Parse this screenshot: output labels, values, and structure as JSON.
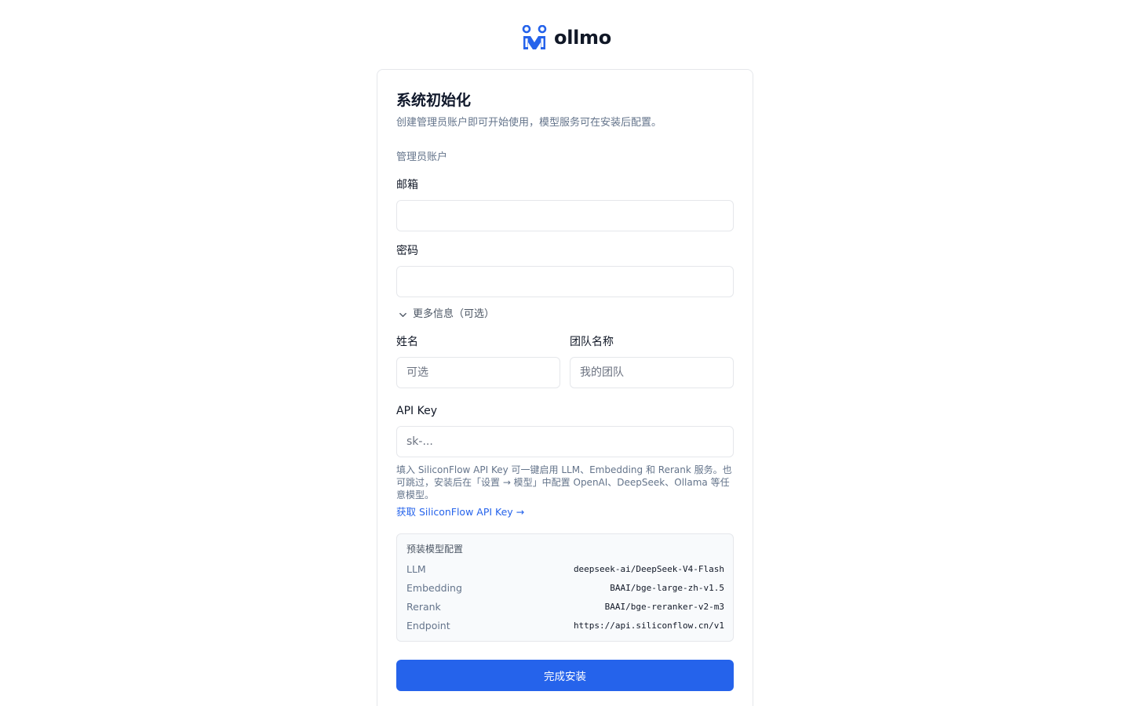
{
  "brand": {
    "name": "ollmo",
    "logo_color": "#2563eb"
  },
  "setup": {
    "title": "系统初始化",
    "subtitle": "创建管理员账户即可开始使用，模型服务可在安装后配置。",
    "section_label": "管理员账户",
    "email": {
      "label": "邮箱",
      "value": "",
      "placeholder": ""
    },
    "password": {
      "label": "密码",
      "value": "",
      "placeholder": ""
    },
    "more_info_toggle": "更多信息（可选）",
    "name": {
      "label": "姓名",
      "placeholder": "可选"
    },
    "team": {
      "label": "团队名称",
      "placeholder": "我的团队"
    },
    "api_key": {
      "label": "API Key",
      "placeholder": "sk-...",
      "hint": "填入 SiliconFlow API Key 可一键启用 LLM、Embedding 和 Rerank 服务。也可跳过，安装后在「设置 → 模型」中配置 OpenAI、DeepSeek、Ollama 等任意模型。",
      "link": "获取 SiliconFlow API Key →"
    },
    "preset": {
      "title": "预装模型配置",
      "rows": [
        {
          "key": "LLM",
          "value": "deepseek-ai/DeepSeek-V4-Flash"
        },
        {
          "key": "Embedding",
          "value": "BAAI/bge-large-zh-v1.5"
        },
        {
          "key": "Rerank",
          "value": "BAAI/bge-reranker-v2-m3"
        },
        {
          "key": "Endpoint",
          "value": "https://api.siliconflow.cn/v1"
        }
      ]
    },
    "submit_label": "完成安装"
  }
}
